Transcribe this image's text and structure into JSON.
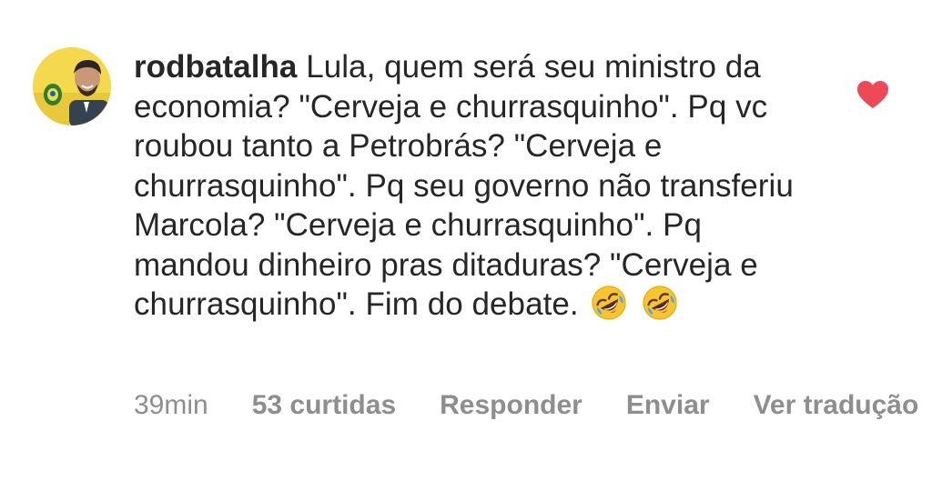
{
  "comment": {
    "username": "rodbatalha",
    "text": "Lula, quem será seu ministro da economia? \"Cerveja e churrasquinho\". Pq vc roubou tanto a Petrobrás? \"Cerveja e churrasquinho\". Pq seu governo não transferiu Marcola? \"Cerveja e churrasquinho\". Pq mandou dinheiro pras ditaduras? \"Cerveja e churrasquinho\". Fim do debate.",
    "emojis": [
      "rolling-on-floor-laughing",
      "rolling-on-floor-laughing"
    ],
    "liked": true
  },
  "meta": {
    "time": "39min",
    "likes": "53 curtidas",
    "reply": "Responder",
    "send": "Enviar",
    "translate": "Ver tradução"
  },
  "colors": {
    "text": "#262626",
    "meta": "#8e8e8e",
    "heart": "#ed4956",
    "background": "#ffffff"
  }
}
